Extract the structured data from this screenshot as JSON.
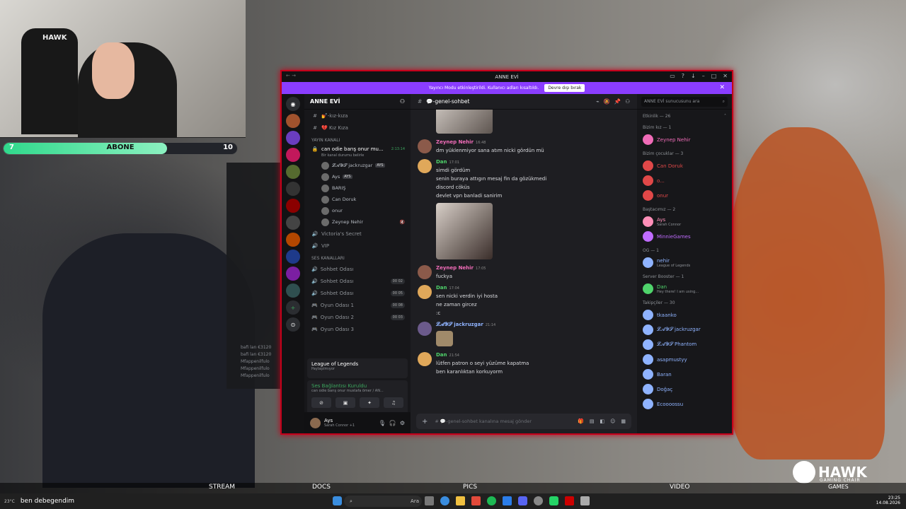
{
  "stream_overlay": {
    "cam_chair_label": "HAWK",
    "sub_goal": {
      "label": "ABONE",
      "progress": 0.7,
      "current": "7",
      "target": "10"
    },
    "bottom_bar": [
      "STREAM",
      "DOCS",
      "PICS",
      "VIDEO"
    ],
    "games_label": "GAMES",
    "brand": {
      "name": "HAWK",
      "tagline": "GAMING CHAIR"
    },
    "side_panel_lines": [
      "bafi lan  €3120",
      "bafi lan  €3120",
      "Mfappenilfulo",
      "Mfappenilfulo",
      "Mfappenilfulo"
    ]
  },
  "window": {
    "title": "ANNE EVİ",
    "banner_text": "Yayıncı Modu etkinleştirildi. Kullanıcı adları kısaltıldı.",
    "banner_button": "Devre dışı bırak"
  },
  "server": {
    "name": "ANNE EVİ",
    "channels_top": [
      {
        "icon": "#",
        "label": "💅-kız-kıza"
      },
      {
        "icon": "#",
        "label": "💔 Kız Kıza"
      }
    ],
    "stream_category": "YAYIN KANALI",
    "stream_channel": {
      "label": "can odie barış onur mu...",
      "time": "2:13:14",
      "sub": "Bir kanal durumu belirle"
    },
    "stream_users": [
      {
        "name": "𝓛𝓐𝓨𝓢 jackruzgar",
        "badge": "AYS"
      },
      {
        "name": "Ays",
        "badge": "AYS"
      },
      {
        "name": "BARIŞ",
        "badge": ""
      },
      {
        "name": "Can Doruk",
        "badge": ""
      },
      {
        "name": "onur",
        "badge": ""
      },
      {
        "name": "Zeynep Nehir",
        "badge": ""
      }
    ],
    "channels_mid": [
      {
        "icon": "🔊",
        "label": "Victoria's Secret"
      },
      {
        "icon": "🔊",
        "label": "VIP"
      }
    ],
    "voice_category": "SES KANALLARI",
    "voice_channels": [
      {
        "label": "Sohbet Odası",
        "count": ""
      },
      {
        "label": "Sohbet Odası",
        "count": "00 02"
      },
      {
        "label": "Sohbet Odası",
        "count": "00 05"
      },
      {
        "label": "Oyun Odası 1",
        "count": "00 08"
      },
      {
        "label": "Oyun Odası 2",
        "count": "00 03"
      },
      {
        "label": "Oyun Odası 3",
        "count": ""
      }
    ],
    "activity": {
      "title": "League of Legends",
      "sub": "Paylaşılmıyor"
    },
    "voice_status": {
      "title": "Ses Bağlantısı Kuruldu",
      "sub": "can odie barış onur mustafa ömer / AN..."
    },
    "user": {
      "name": "Ays",
      "status": "Sarah Connor +1"
    }
  },
  "chat": {
    "channel": "💬-genel-sohbet",
    "messages": [
      {
        "name": "Zeynep Nehir",
        "color": "#f06cb8",
        "time": "16:48",
        "lines": [
          "dm yüklenmiyor sana atım nicki gördün mü"
        ]
      },
      {
        "name": "Dan",
        "color": "#4fd36b",
        "time": "17:01",
        "lines": [
          "simdi gördüm",
          "senin buraya attıgın mesaj fin da gözükmedi",
          "discord cöküs",
          "devlet vpn banladi sanirim"
        ]
      },
      {
        "name": "Zeynep Nehir",
        "color": "#f06cb8",
        "time": "17:05",
        "lines": [
          "fuckya"
        ]
      },
      {
        "name": "Dan",
        "color": "#4fd36b",
        "time": "17:04",
        "lines": [
          "sen nicki verdin iyi hosta",
          "ne zaman gircez",
          ":c"
        ]
      },
      {
        "name": "𝓛𝓐𝓨𝓢 jackruzgar",
        "color": "#8fb3ff",
        "time": "21:14",
        "lines": []
      },
      {
        "name": "Dan",
        "color": "#4fd36b",
        "time": "21:54",
        "lines": [
          "lütfen patron o seyi yüzüme kapatma",
          "ben karanlıktan korkuyorm"
        ]
      }
    ],
    "input_placeholder": "# 💬-genel-sohbet kanalına mesaj gönder"
  },
  "members": {
    "search_placeholder": "ANNE EVİ sunucusunu ara",
    "activity_label": "Etkinlik — 26",
    "groups": [
      {
        "label": "Bizim kız — 1",
        "members": [
          {
            "name": "Zeynep Nehir",
            "color": "#f06cb8",
            "sub": ""
          }
        ]
      },
      {
        "label": "Bizim çocuklar — 3",
        "members": [
          {
            "name": "Can Doruk",
            "color": "#e04848",
            "sub": ""
          },
          {
            "name": "o...",
            "color": "#e04848",
            "sub": ""
          },
          {
            "name": "onur",
            "color": "#e04848",
            "sub": ""
          }
        ]
      },
      {
        "label": "Baştacımız — 2",
        "members": [
          {
            "name": "Ays",
            "color": "#ff8fb8",
            "sub": "Sarah Connor"
          },
          {
            "name": "MinnieGames",
            "color": "#c06cff",
            "sub": ""
          }
        ]
      },
      {
        "label": "OG — 1",
        "members": [
          {
            "name": "nehir",
            "color": "#8fb3ff",
            "sub": "League of Legends"
          }
        ]
      },
      {
        "label": "Server Booster — 1",
        "members": [
          {
            "name": "Dan",
            "color": "#4fd36b",
            "sub": "Hey there! I am using..."
          }
        ]
      },
      {
        "label": "Takipçiler — 30",
        "members": [
          {
            "name": "tkaanko",
            "color": "#8fb3ff",
            "sub": ""
          },
          {
            "name": "𝓛𝓐𝓨𝓢 jackruzgar",
            "color": "#8fb3ff",
            "sub": ""
          },
          {
            "name": "𝓛𝓐𝓨𝓢 Phantom",
            "color": "#8fb3ff",
            "sub": ""
          },
          {
            "name": "asapmustyy",
            "color": "#8fb3ff",
            "sub": ""
          },
          {
            "name": "Baran",
            "color": "#8fb3ff",
            "sub": ""
          },
          {
            "name": "Doğaç",
            "color": "#8fb3ff",
            "sub": ""
          },
          {
            "name": "Ecoooossu",
            "color": "#8fb3ff",
            "sub": ""
          }
        ]
      }
    ]
  },
  "taskbar": {
    "weather": "23°C",
    "news": "ben debegendim",
    "search": "Ara",
    "time": "23:25",
    "date": "14.08.2026"
  }
}
